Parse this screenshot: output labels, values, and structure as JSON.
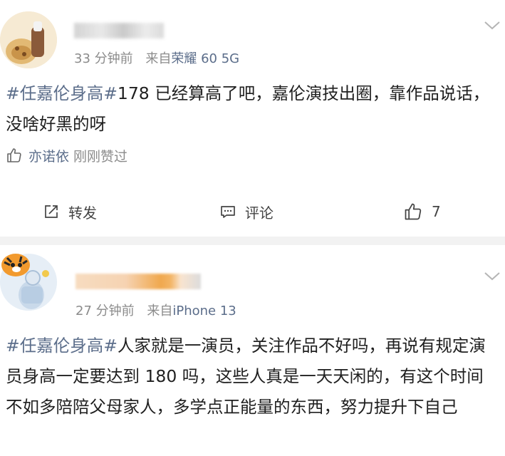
{
  "posts": [
    {
      "time": "33 分钟前",
      "source_prefix": "来自",
      "source": "荣耀 60 5G",
      "hashtag": "#任嘉伦身高#",
      "text": "178 已经算高了吧，嘉伦演技出圈，靠作品说话，没啥好黑的呀",
      "like_by": "亦诺依",
      "like_note": "刚刚赞过",
      "repost_label": "转发",
      "comment_label": "评论",
      "like_count": "7"
    },
    {
      "time": "27 分钟前",
      "source_prefix": "来自",
      "source": "iPhone 13",
      "hashtag": "#任嘉伦身高#",
      "text": "人家就是一演员，关注作品不好吗，再说有规定演员身高一定要达到 180 吗，这些人真是一天天闲的，有这个时间不如多陪陪父母家人，多学点正能量的东西，努力提升下自己"
    }
  ],
  "icons": {
    "more": "chevron-down-icon",
    "repost": "repost-icon",
    "comment": "comment-icon",
    "like": "thumbs-up-icon"
  },
  "colors": {
    "link": "#5b6d8a",
    "meta": "#8b8b8b",
    "divider": "#f2f2f2"
  }
}
